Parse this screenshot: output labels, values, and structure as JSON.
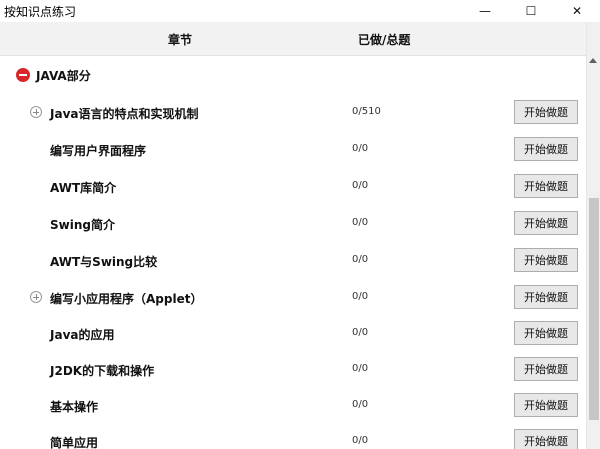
{
  "window": {
    "title": "按知识点练习",
    "minimize_glyph": "—",
    "maximize_glyph": "☐",
    "close_glyph": "✕"
  },
  "header": {
    "chapter_label": "章节",
    "progress_label": "已做/总题"
  },
  "section": {
    "label": "JAVA部分",
    "icon": "collapse-minus-icon",
    "icon_color": "#d9262b"
  },
  "rows": [
    {
      "title": "Java语言的特点和实现机制",
      "progress": "0/510",
      "button": "开始做题",
      "expandable": true
    },
    {
      "title": "编写用户界面程序",
      "progress": "0/0",
      "button": "开始做题",
      "expandable": false
    },
    {
      "title": "AWT库简介",
      "progress": "0/0",
      "button": "开始做题",
      "expandable": false
    },
    {
      "title": "Swing简介",
      "progress": "0/0",
      "button": "开始做题",
      "expandable": false
    },
    {
      "title": "AWT与Swing比较",
      "progress": "0/0",
      "button": "开始做题",
      "expandable": false
    },
    {
      "title": "编写小应用程序（Applet）",
      "progress": "0/0",
      "button": "开始做题",
      "expandable": true
    },
    {
      "title": "Java的应用",
      "progress": "0/0",
      "button": "开始做题",
      "expandable": false
    },
    {
      "title": "J2DK的下载和操作",
      "progress": "0/0",
      "button": "开始做题",
      "expandable": false
    },
    {
      "title": "基本操作",
      "progress": "0/0",
      "button": "开始做题",
      "expandable": false
    },
    {
      "title": "简单应用",
      "progress": "0/0",
      "button": "开始做题",
      "expandable": false
    }
  ]
}
